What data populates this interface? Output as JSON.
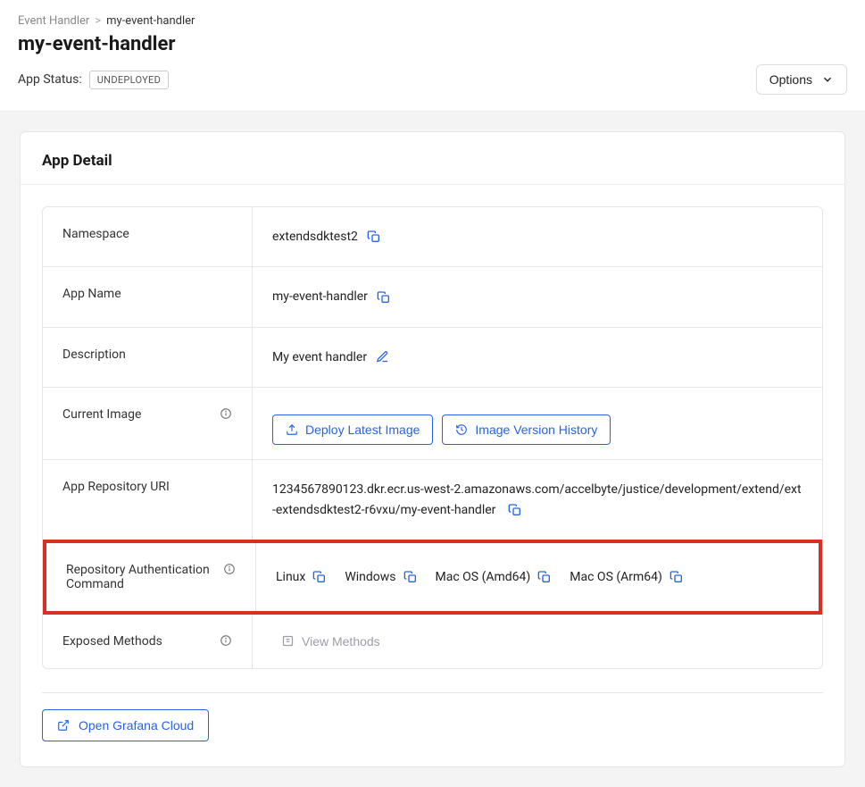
{
  "breadcrumb": {
    "root": "Event Handler",
    "sep": ">",
    "current": "my-event-handler"
  },
  "title": "my-event-handler",
  "status": {
    "label": "App Status:",
    "value": "UNDEPLOYED"
  },
  "options_label": "Options",
  "card_title": "App Detail",
  "rows": {
    "namespace": {
      "label": "Namespace",
      "value": "extendsdktest2"
    },
    "appname": {
      "label": "App Name",
      "value": "my-event-handler"
    },
    "description": {
      "label": "Description",
      "value": "My event handler"
    },
    "current_image": {
      "label": "Current Image"
    },
    "repo_uri": {
      "label": "App Repository URI",
      "value": "1234567890123.dkr.ecr.us-west-2.amazonaws.com/accelbyte/justice/development/extend/ext-extendsdktest2-r6vxu/my-event-handler"
    },
    "auth_cmd": {
      "label": "Repository Authentication Command",
      "items": [
        "Linux",
        "Windows",
        "Mac OS (Amd64)",
        "Mac OS (Arm64)"
      ]
    },
    "exposed": {
      "label": "Exposed Methods"
    }
  },
  "buttons": {
    "deploy": "Deploy Latest Image",
    "history": "Image Version History",
    "view_methods": "View Methods",
    "grafana": "Open Grafana Cloud"
  }
}
